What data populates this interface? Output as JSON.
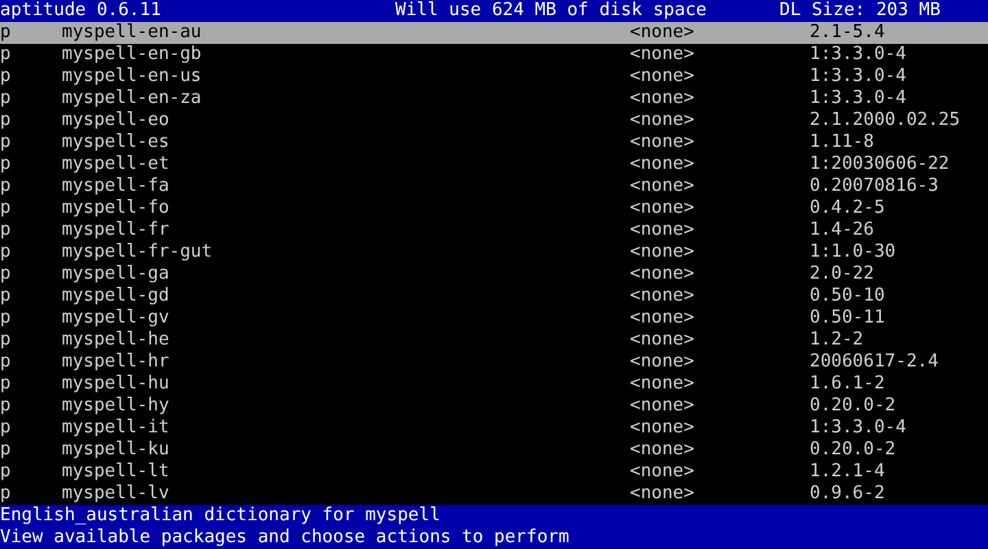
{
  "header": {
    "title": "aptitude 0.6.11",
    "disk_usage": "Will use 624 MB of disk space",
    "download_size": "DL Size: 203 MB"
  },
  "packages": [
    {
      "state": "p",
      "name": "myspell-en-au",
      "installed": "<none>",
      "candidate": "2.1-5.4",
      "selected": true
    },
    {
      "state": "p",
      "name": "myspell-en-gb",
      "installed": "<none>",
      "candidate": "1:3.3.0-4",
      "selected": false
    },
    {
      "state": "p",
      "name": "myspell-en-us",
      "installed": "<none>",
      "candidate": "1:3.3.0-4",
      "selected": false
    },
    {
      "state": "p",
      "name": "myspell-en-za",
      "installed": "<none>",
      "candidate": "1:3.3.0-4",
      "selected": false
    },
    {
      "state": "p",
      "name": "myspell-eo",
      "installed": "<none>",
      "candidate": "2.1.2000.02.25",
      "selected": false
    },
    {
      "state": "p",
      "name": "myspell-es",
      "installed": "<none>",
      "candidate": "1.11-8",
      "selected": false
    },
    {
      "state": "p",
      "name": "myspell-et",
      "installed": "<none>",
      "candidate": "1:20030606-22",
      "selected": false
    },
    {
      "state": "p",
      "name": "myspell-fa",
      "installed": "<none>",
      "candidate": "0.20070816-3",
      "selected": false
    },
    {
      "state": "p",
      "name": "myspell-fo",
      "installed": "<none>",
      "candidate": "0.4.2-5",
      "selected": false
    },
    {
      "state": "p",
      "name": "myspell-fr",
      "installed": "<none>",
      "candidate": "1.4-26",
      "selected": false
    },
    {
      "state": "p",
      "name": "myspell-fr-gut",
      "installed": "<none>",
      "candidate": "1:1.0-30",
      "selected": false
    },
    {
      "state": "p",
      "name": "myspell-ga",
      "installed": "<none>",
      "candidate": "2.0-22",
      "selected": false
    },
    {
      "state": "p",
      "name": "myspell-gd",
      "installed": "<none>",
      "candidate": "0.50-10",
      "selected": false
    },
    {
      "state": "p",
      "name": "myspell-gv",
      "installed": "<none>",
      "candidate": "0.50-11",
      "selected": false
    },
    {
      "state": "p",
      "name": "myspell-he",
      "installed": "<none>",
      "candidate": "1.2-2",
      "selected": false
    },
    {
      "state": "p",
      "name": "myspell-hr",
      "installed": "<none>",
      "candidate": "20060617-2.4",
      "selected": false
    },
    {
      "state": "p",
      "name": "myspell-hu",
      "installed": "<none>",
      "candidate": "1.6.1-2",
      "selected": false
    },
    {
      "state": "p",
      "name": "myspell-hy",
      "installed": "<none>",
      "candidate": "0.20.0-2",
      "selected": false
    },
    {
      "state": "p",
      "name": "myspell-it",
      "installed": "<none>",
      "candidate": "1:3.3.0-4",
      "selected": false
    },
    {
      "state": "p",
      "name": "myspell-ku",
      "installed": "<none>",
      "candidate": "0.20.0-2",
      "selected": false
    },
    {
      "state": "p",
      "name": "myspell-lt",
      "installed": "<none>",
      "candidate": "1.2.1-4",
      "selected": false
    },
    {
      "state": "p",
      "name": "myspell-lv",
      "installed": "<none>",
      "candidate": "0.9.6-2",
      "selected": false
    }
  ],
  "description": "English_australian dictionary for myspell",
  "status_line": "View available packages and choose actions to perform"
}
